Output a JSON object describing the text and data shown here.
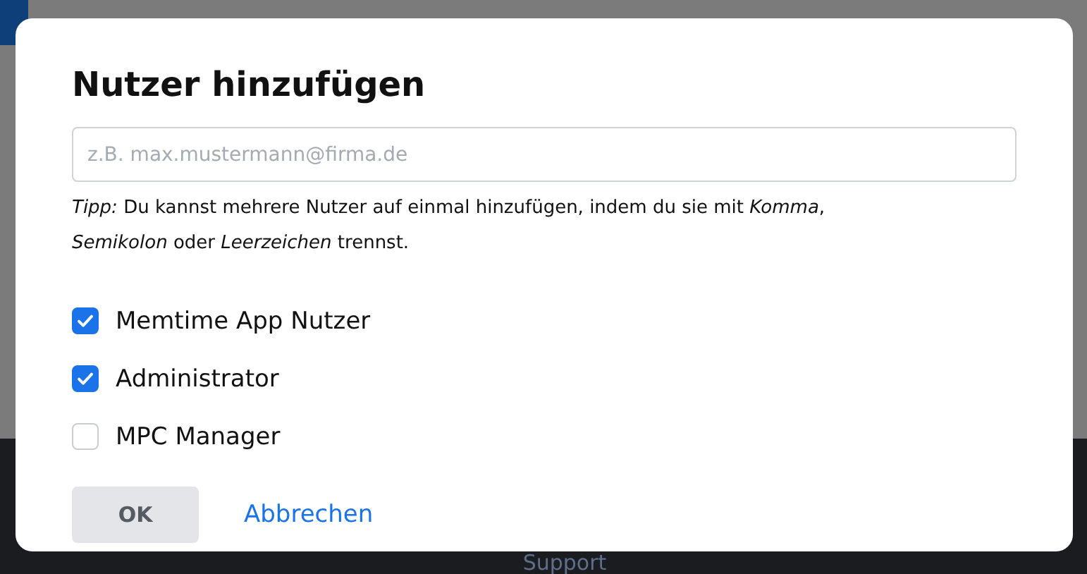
{
  "background": {
    "footer_link": "Support"
  },
  "dialog": {
    "title": "Nutzer hinzufügen",
    "email_field": {
      "placeholder": "z.B. max.mustermann@firma.de"
    },
    "hint": "*Tipp:* Du kannst mehrere Nutzer auf einmal hinzufügen, indem du sie mit *Komma*, *Semikolon* oder *Leerzeichen* trennst.",
    "roles": [
      {
        "label": "Memtime App Nutzer",
        "checked": true
      },
      {
        "label": "Administrator",
        "checked": true
      },
      {
        "label": "MPC Manager",
        "checked": false
      }
    ],
    "buttons": {
      "ok": "OK",
      "cancel": "Abbrechen"
    }
  }
}
